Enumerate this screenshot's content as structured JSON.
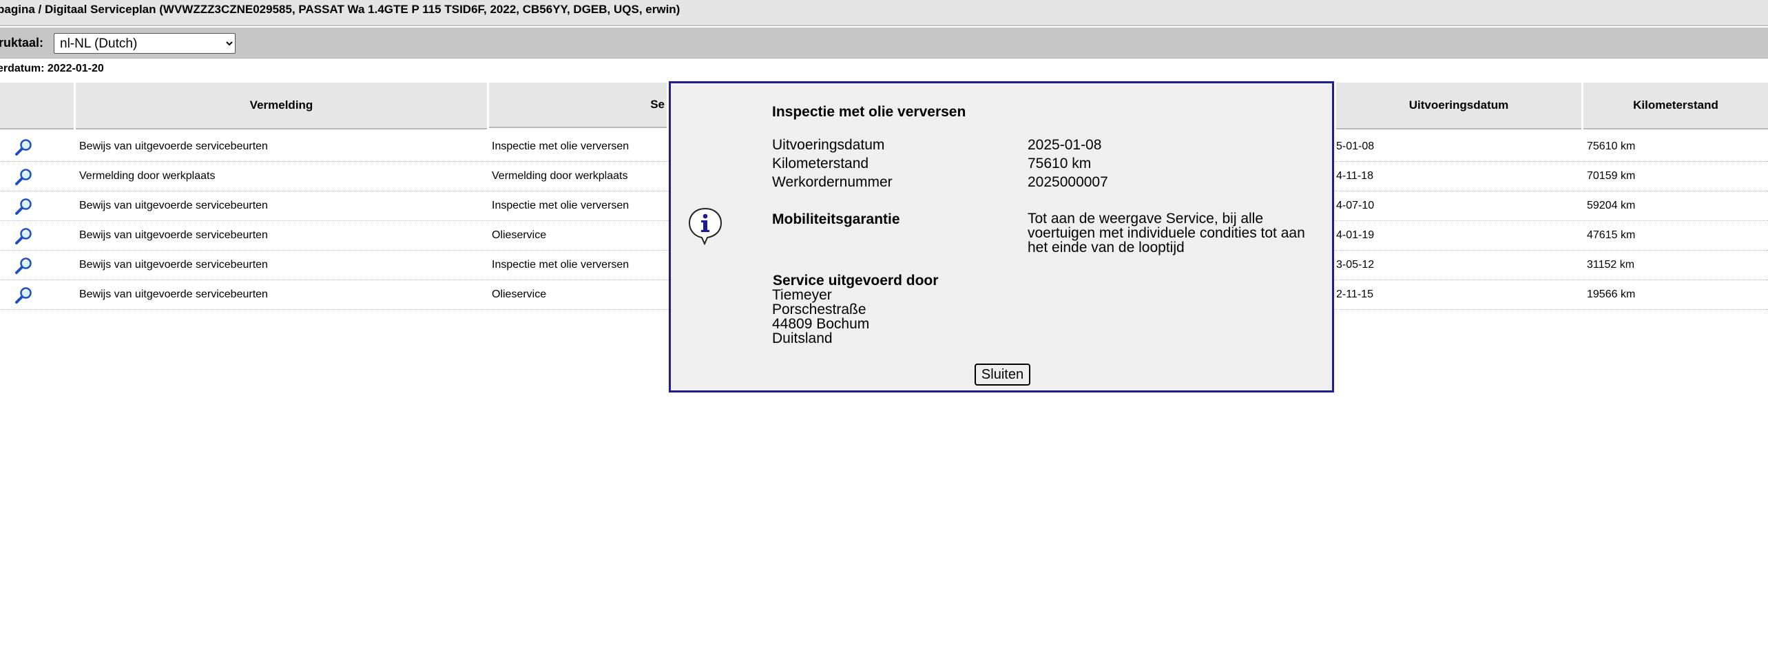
{
  "breadcrumb": "pagina / Digitaal Serviceplan (WVWZZZ3CZNE029585, PASSAT Wa 1.4GTE P 115 TSID6F, 2022, CB56YY, DGEB, UQS, erwin)",
  "language": {
    "label": "ruktaal:",
    "selected": "nl-NL (Dutch)"
  },
  "order_date": "erdatum: 2022-01-20",
  "table": {
    "headers": {
      "vermelding": "Vermelding",
      "service": "Se",
      "uitvoeringsdatum": "Uitvoeringsdatum",
      "kilometerstand": "Kilometerstand"
    },
    "rows": [
      {
        "vermelding": "Bewijs van uitgevoerde servicebeurten",
        "service": "Inspectie met olie verversen",
        "datum": "5-01-08",
        "km": "75610 km"
      },
      {
        "vermelding": "Vermelding door werkplaats",
        "service": "Vermelding door werkplaats",
        "datum": "4-11-18",
        "km": "70159 km"
      },
      {
        "vermelding": "Bewijs van uitgevoerde servicebeurten",
        "service": "Inspectie met olie verversen",
        "datum": "4-07-10",
        "km": "59204 km"
      },
      {
        "vermelding": "Bewijs van uitgevoerde servicebeurten",
        "service": "Olieservice",
        "datum": "4-01-19",
        "km": "47615 km"
      },
      {
        "vermelding": "Bewijs van uitgevoerde servicebeurten",
        "service": "Inspectie met olie verversen",
        "datum": "3-05-12",
        "km": "31152 km"
      },
      {
        "vermelding": "Bewijs van uitgevoerde servicebeurten",
        "service": "Olieservice",
        "datum": "2-11-15",
        "km": "19566 km"
      }
    ]
  },
  "modal": {
    "title": "Inspectie met olie verversen",
    "fields": [
      {
        "label": "Uitvoeringsdatum",
        "value": "2025-01-08"
      },
      {
        "label": "Kilometerstand",
        "value": "75610 km"
      },
      {
        "label": "Werkordernummer",
        "value": "2025000007"
      }
    ],
    "mobility": {
      "label": "Mobiliteitsgarantie",
      "value": "Tot aan de weergave Service, bij alle voertuigen met individuele condities tot aan het einde van de looptijd"
    },
    "performed_by": {
      "label": "Service uitgevoerd door",
      "lines": [
        "Tiemeyer",
        "Porschestraße",
        "44809 Bochum",
        "Duitsland"
      ]
    },
    "close_label": "Sluiten"
  },
  "colors": {
    "modal_border": "#1e1e8c",
    "icon_blue": "#1a1aa0"
  }
}
